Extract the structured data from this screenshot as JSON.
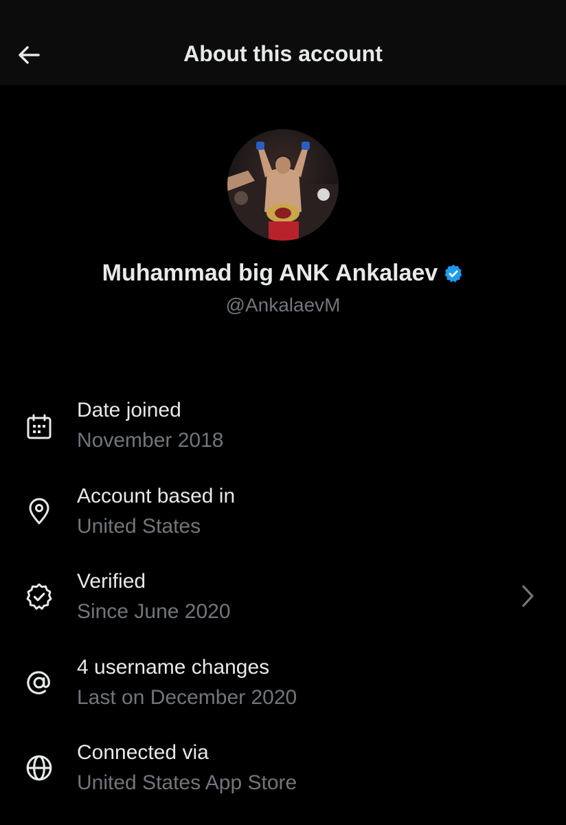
{
  "header": {
    "title": "About this account",
    "back_icon": "arrow-left-icon"
  },
  "profile": {
    "display_name": "Muhammad big ANK Ankalaev",
    "handle": "@AnkalaevM",
    "verified_badge_color": "#1d9bf0"
  },
  "details": [
    {
      "icon": "calendar-icon",
      "label": "Date joined",
      "value": "November 2018"
    },
    {
      "icon": "location-pin-icon",
      "label": "Account based in",
      "value": "United States"
    },
    {
      "icon": "verified-badge-icon",
      "label": "Verified",
      "value": "Since June 2020",
      "has_chevron": true
    },
    {
      "icon": "at-sign-icon",
      "label": "4 username changes",
      "value": "Last on December 2020"
    },
    {
      "icon": "globe-icon",
      "label": "Connected via",
      "value": "United States App Store"
    }
  ],
  "colors": {
    "background": "#000000",
    "header_background": "#0c0c0c",
    "primary_text": "#e7e9ea",
    "secondary_text": "#71767b",
    "accent": "#1d9bf0"
  }
}
